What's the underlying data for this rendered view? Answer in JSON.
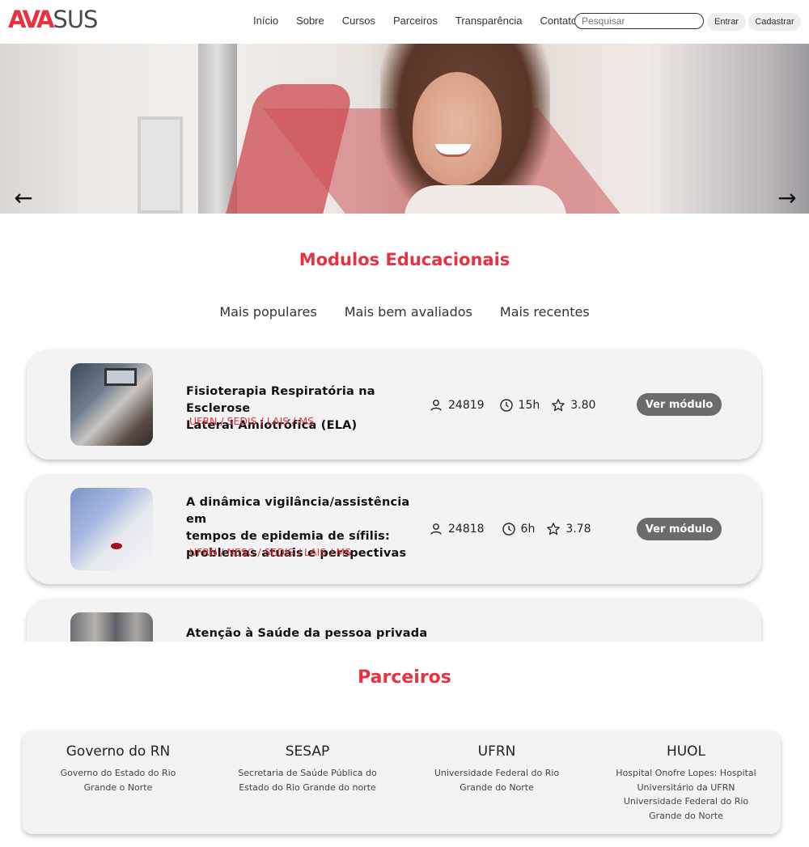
{
  "header": {
    "logo_red": "AVA",
    "logo_gray": "SUS",
    "nav": [
      "Início",
      "Sobre",
      "Cursos",
      "Parceiros",
      "Transparência",
      "Contato"
    ],
    "search_placeholder": "Pesquisar",
    "entrar": "Entrar",
    "cadastrar": "Cadastrar"
  },
  "hero": {
    "prev_icon": "arrow-left-icon",
    "next_icon": "arrow-right-icon"
  },
  "modules": {
    "title": "Modulos Educacionais",
    "tabs": [
      "Mais populares",
      "Mais bem avaliados",
      "Mais recentes"
    ],
    "items": [
      {
        "title_lines": [
          "Fisioterapia Respiratória na Esclerose",
          "Lateral Amiotrófica (ELA)"
        ],
        "org": "UFRN / SEDIS / LAIS / MS",
        "students": "24819",
        "duration": "15h",
        "rating": "3.80",
        "button": "Ver módulo"
      },
      {
        "title_lines": [
          "A dinâmica vigilância/assistência em",
          "tempos de epidemia de sífilis:",
          "problemas atuais e perspectivas"
        ],
        "org": "UFRN / NESC / SEDIS / LAIS / MS",
        "students": "24818",
        "duration": "6h",
        "rating": "3.78",
        "button": "Ver módulo"
      },
      {
        "title_lines": [
          "Atenção à Saúde da pessoa privada"
        ]
      }
    ]
  },
  "partners": {
    "title": "Parceiros",
    "items": [
      {
        "name": "Governo do RN",
        "desc_lines": [
          "Governo do Estado do Rio",
          "Grande o Norte"
        ]
      },
      {
        "name": "SESAP",
        "desc_lines": [
          "Secretaria de Saúde Pública do",
          "Estado do Rio Grande do norte"
        ]
      },
      {
        "name": "UFRN",
        "desc_lines": [
          "Universidade Federal do Rio",
          "Grande do Norte"
        ]
      },
      {
        "name": "HUOL",
        "desc_lines": [
          "Hospital Onofre Lopes: Hospital",
          "Universitário da UFRN",
          "Universidade Federal do Rio",
          "Grande do Norte"
        ]
      }
    ]
  }
}
